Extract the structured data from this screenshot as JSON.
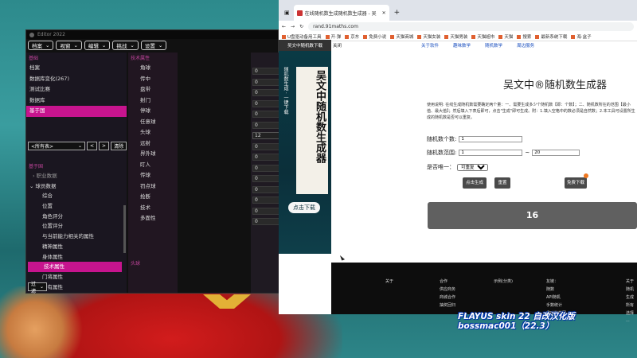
{
  "editor": {
    "title": "Editor 2022",
    "menus": [
      "档案",
      "视窗",
      "编辑",
      "挑战",
      "设置"
    ],
    "left_section_title": "基础",
    "left_items": [
      "档案",
      "数据库变化(267)",
      "测试比赛",
      "数据库",
      "基于国"
    ],
    "left_selected": 4,
    "nav_select": "<所有表>",
    "nav_prev": "<",
    "nav_next": ">",
    "nav_clear": "清除",
    "tree_section_title": "基于国",
    "tree_items": [
      "职业数据",
      "球员数据",
      "综合",
      "位置",
      "角色评分",
      "位置评分",
      "与当前能力相关的属性",
      "精神属性",
      "身体属性",
      "技术属性",
      "门将属性",
      "所有属性"
    ],
    "tree_selected": 9,
    "filter_label": "过滤",
    "mid_section_title": "技术属性",
    "mid_items": [
      "角球",
      "传中",
      "盘带",
      "射门",
      "停球",
      "任意球",
      "头球",
      "远射",
      "界外球",
      "盯人",
      "传球",
      "罚点球",
      "抢断",
      "技术",
      "多面性"
    ],
    "values": [
      "0",
      "0",
      "0",
      "0",
      "0",
      "0",
      "12",
      "0",
      "0",
      "0",
      "0",
      "0",
      "0",
      "0",
      "0"
    ],
    "active_value_index": 6,
    "bottom_section_title": "头球"
  },
  "browser": {
    "tab_title": "在线随机数生成随机数生成器 - 吴",
    "url": "rand.91maths.com",
    "bookmarks": [
      "U盘驱动备用工具",
      "开·弹",
      "京东",
      "免费小说",
      "天猫商城",
      "天猫女装",
      "天猫男装",
      "天猫超市",
      "天猫",
      "搜索",
      "最新系统下载",
      "海·盒子"
    ],
    "logo": "吴文中随机数下载",
    "logo_short": "关闭",
    "nav_links": [
      "关于软件",
      "趣味数学",
      "随机数学",
      "周边服务"
    ],
    "banner_vertical_title": "吴文中随机数生成器",
    "banner_vertical_sub": "随机数生成 · 一键下载",
    "banner_download": "点击下载",
    "main_title": "吴文中®随机数生成器",
    "description": "使用说明: 在线生成随机数需要确定两个量：一、需要生成多少个随机数【即：个数】；二、随机数所在的范围【最小值、最大值】；然后填入下表后即可，点击\"生成\"即可生成。附：1.填入空格中的数必须是自然数；2.本工具可设置所生成的随机数是否可以重复。",
    "count_label": "随机数个数:",
    "count_value": "1",
    "range_label": "随机数范围:",
    "range_min": "1",
    "range_sep": "~",
    "range_max": "20",
    "unique_label": "是否唯一：",
    "unique_value": "可重复",
    "generate_btn": "点击生成",
    "reset_btn": "重置",
    "download_btn": "免费下载",
    "result": "16",
    "footer_cols": [
      {
        "title": "关于",
        "items": []
      },
      {
        "title": "合作",
        "items": [
          "供应商务",
          "商城合作",
          "抽奖回归"
        ]
      },
      {
        "title": "示例(分类)",
        "items": []
      },
      {
        "title": "友链：",
        "items": [
          "随数",
          "API随机",
          "手数统计",
          "趣味数学园"
        ]
      },
      {
        "title": "关于",
        "items": [
          "随机",
          "生成",
          "所有",
          "选择",
          "..."
        ]
      }
    ]
  },
  "watermark": {
    "line1": "FLAYUS skin 22 自改汉化版",
    "line2": "bossmac001（22.3）"
  }
}
